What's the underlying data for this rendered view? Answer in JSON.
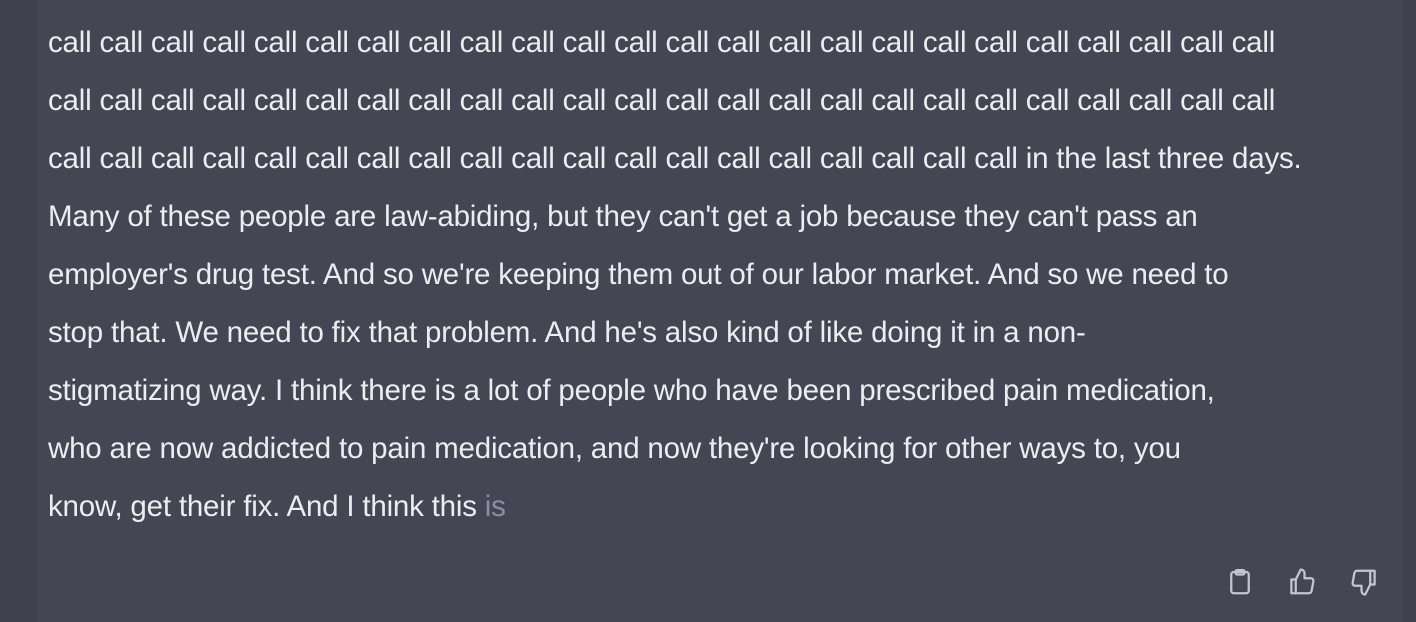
{
  "message": {
    "text": "call call call call call call call call call call call call call call call call call call call call call call call call\ncall call call call call call call call call call call call call call call call call call call call call call call call\ncall call call call call call call call call call call call call call call call call call call in the last three days.\nMany of these people are law-abiding, but they can't get a job because they can't pass an\nemployer's drug test. And so we're keeping them out of our labor market. And so we need to\nstop that. We need to fix that problem. And he's also kind of like doing it in a non-\nstigmatizing way. I think there is a lot of people who have been prescribed pain medication,\nwho are now addicted to pain medication, and now they're looking for other ways to, you\nknow, get their fix. And I think this ",
    "streaming_tail": "is"
  },
  "actions": {
    "copy_icon": "clipboard-icon",
    "like_icon": "thumbs-up-icon",
    "dislike_icon": "thumbs-down-icon"
  },
  "colors": {
    "background": "#444654",
    "text": "#ececf1",
    "faded_text": "#8e8ea0",
    "icon": "#c5c5d2"
  }
}
